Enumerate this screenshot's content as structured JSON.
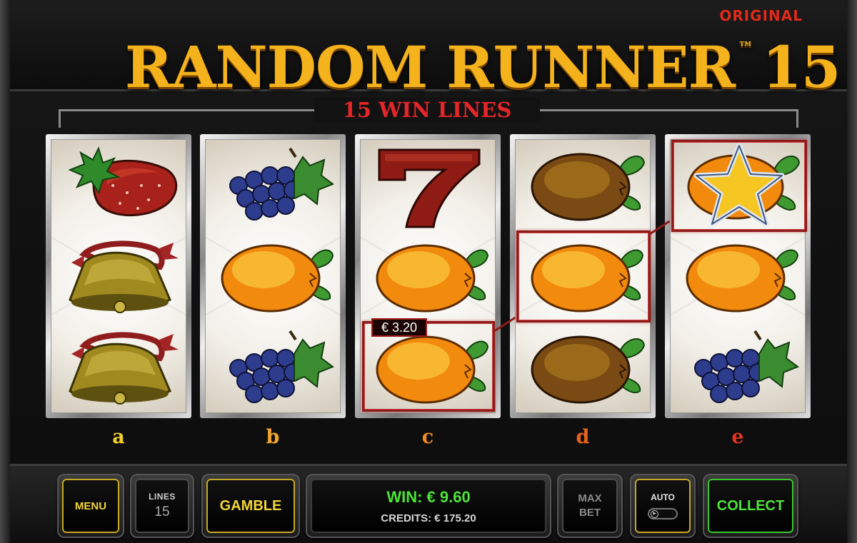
{
  "header": {
    "edition": "ORIGINAL",
    "title": "RANDOM RUNNER",
    "trademark": "™",
    "title_number": "15",
    "lines_banner": "15 WIN LINES"
  },
  "reels": [
    {
      "letter": "a",
      "letter_color": "#f2cf2a",
      "symbols": [
        "strawberry-symbol",
        "bell-symbol",
        "bell-symbol"
      ]
    },
    {
      "letter": "b",
      "letter_color": "#f2a52a",
      "symbols": [
        "grapes-symbol",
        "orange-symbol",
        "grapes-symbol"
      ]
    },
    {
      "letter": "c",
      "letter_color": "#f08a22",
      "symbols": [
        "seven-symbol",
        "orange-symbol",
        "orange-symbol"
      ]
    },
    {
      "letter": "d",
      "letter_color": "#e8621e",
      "symbols": [
        "plum-symbol",
        "orange-symbol",
        "plum-symbol"
      ]
    },
    {
      "letter": "e",
      "letter_color": "#e23322",
      "symbols": [
        "star-symbol",
        "orange-symbol",
        "grapes-symbol"
      ]
    }
  ],
  "win_line": {
    "amount": "€ 3.20",
    "highlighted_cells": [
      "c-row3",
      "d-row2",
      "e-row1"
    ]
  },
  "controls": {
    "menu_label": "MENU",
    "lines_caption": "LINES",
    "lines_value": "15",
    "gamble_label": "GAMBLE",
    "win_text": "WIN: € 9.60",
    "credits_text": "CREDITS: € 175.20",
    "max_label": "MAX",
    "bet_label": "BET",
    "auto_label": "AUTO",
    "auto_enabled": false,
    "collect_label": "COLLECT"
  },
  "colors": {
    "title_gold": "#f4b21c",
    "banner_red": "#e4262a",
    "win_green": "#4ee43a",
    "button_gold": "#f0d535",
    "win_box_red": "#8e1a1a"
  }
}
